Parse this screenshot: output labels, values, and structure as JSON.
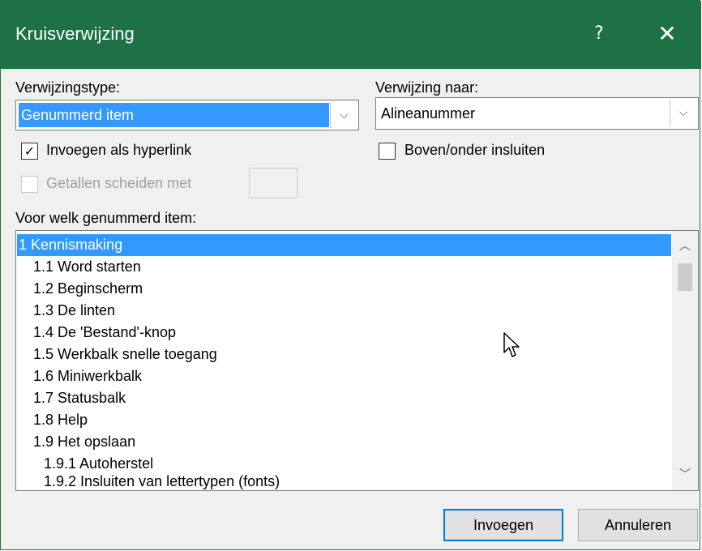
{
  "window": {
    "title": "Kruisverwijzing",
    "help": "?",
    "close": "✕"
  },
  "ref_type": {
    "label": "Verwijzingstype:",
    "value": "Genummerd item"
  },
  "ref_to": {
    "label": "Verwijzing naar:",
    "value": "Alineanummer"
  },
  "insert_hyperlink": {
    "label": "Invoegen als hyperlink",
    "checked": true
  },
  "include_above_below": {
    "label": "Boven/onder insluiten",
    "checked": false
  },
  "separate_numbers": {
    "label": "Getallen scheiden met",
    "value": ""
  },
  "list": {
    "label": "Voor welk genummerd item:",
    "items": [
      {
        "text": "1 Kennismaking",
        "level": 0,
        "selected": true
      },
      {
        "text": "1.1 Word starten",
        "level": 1
      },
      {
        "text": "1.2 Beginscherm",
        "level": 1
      },
      {
        "text": "1.3 De linten",
        "level": 1
      },
      {
        "text": "1.4 De 'Bestand'-knop",
        "level": 1
      },
      {
        "text": "1.5 Werkbalk snelle toegang",
        "level": 1
      },
      {
        "text": "1.6 Miniwerkbalk",
        "level": 1
      },
      {
        "text": "1.7 Statusbalk",
        "level": 1
      },
      {
        "text": "1.8 Help",
        "level": 1
      },
      {
        "text": "1.9 Het opslaan",
        "level": 1
      },
      {
        "text": "1.9.1 Autoherstel",
        "level": 2
      },
      {
        "text": "1.9.2 Insluiten van lettertypen (fonts)",
        "level": 2
      }
    ]
  },
  "buttons": {
    "insert": "Invoegen",
    "cancel": "Annuleren"
  },
  "icons": {
    "dropdown": "chevron-down-icon",
    "check": "checkmark-icon",
    "scroll_up": "chevron-up-icon",
    "scroll_down": "chevron-down-icon"
  },
  "colors": {
    "titlebar": "#1e7145",
    "selection": "#3399ff",
    "default_button_border": "#0078d7"
  }
}
